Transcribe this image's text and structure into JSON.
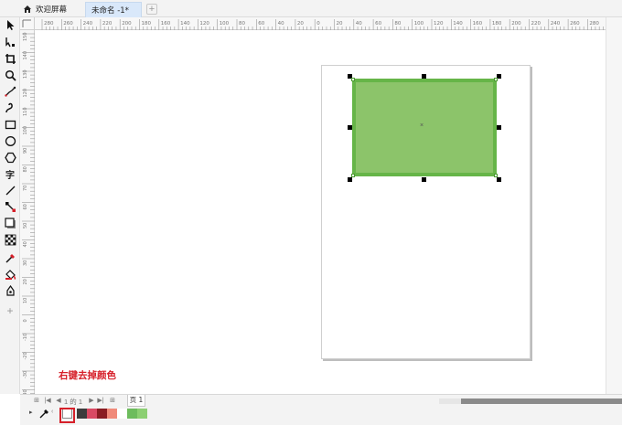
{
  "tabs": {
    "home_label": "欢迎屏幕",
    "document_label": "未命名 -1*",
    "add_label": "+"
  },
  "toolbox": {
    "text_tool_label": "字",
    "add_tool_label": "+"
  },
  "ruler": {
    "h_labels": [
      "280",
      "260",
      "240",
      "220",
      "200",
      "180",
      "160",
      "140",
      "120",
      "100",
      "80",
      "60",
      "40",
      "20",
      "0",
      "20",
      "40",
      "60",
      "80",
      "100",
      "120",
      "140",
      "160",
      "180",
      "200",
      "220",
      "240",
      "260",
      "280"
    ],
    "v_labels": [
      "150",
      "140",
      "130",
      "120",
      "110",
      "100",
      "90",
      "80",
      "70",
      "60",
      "50",
      "40",
      "30",
      "20",
      "10",
      "0",
      "-10",
      "-20",
      "-30",
      "-40"
    ]
  },
  "canvas": {
    "shape_fill": "#8cc46a",
    "shape_outline": "#66b548",
    "center_marker": "×",
    "annotation": "右键去掉颜色",
    "annotation_color": "#d6202a"
  },
  "page_nav": {
    "page_count_text": "1 的 1",
    "page_tab_label": "页 1"
  },
  "palette": {
    "swatches": [
      "#3c3c3c",
      "#d94a63",
      "#8a1c22",
      "#f08a7a",
      "#ffffff",
      "#6dbc5d",
      "#8ccf72"
    ],
    "selected_outline": "#d6202a"
  }
}
